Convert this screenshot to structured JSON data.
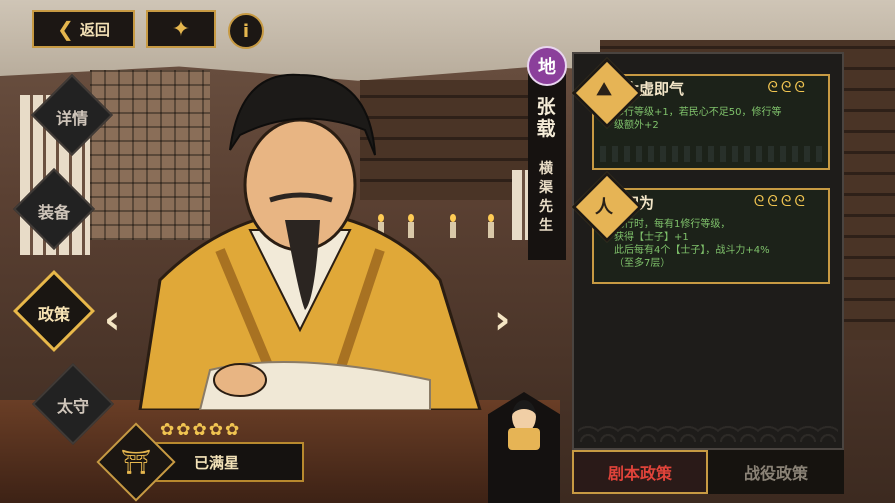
{
  "topbar": {
    "back_label": "返回",
    "back_icon": "chevron-left-icon",
    "gift_icon": "dancer-icon",
    "info_icon": "info-icon",
    "info_glyph": "i"
  },
  "side_nav": {
    "items": [
      {
        "label": "详情",
        "active": false
      },
      {
        "label": "装备",
        "active": false
      },
      {
        "label": "政策",
        "active": true
      },
      {
        "label": "太守",
        "active": false
      }
    ]
  },
  "character": {
    "rank_badge": "地",
    "name": "张载",
    "title": "横渠先生",
    "stars_label": "已满星",
    "stars_count": 5,
    "stars_glyphs": "✿✿✿✿✿"
  },
  "policies": [
    {
      "name": "太虚即气",
      "icon": "mountain-icon",
      "icon_glyph": "⛰",
      "level_glyphs": "ᘓᘓᘓ",
      "level": 3,
      "description": "修行等级+1，若民心不足50，修行等\n级额外+2"
    },
    {
      "name": "四为",
      "icon": "scholar-icon",
      "icon_glyph": "人",
      "level_glyphs": "ᘓᘓᘓᘓ",
      "level": 4,
      "description": "施行时，每有1修行等级，\n获得【士子】+1\n此后每有4个【士子】，战斗力+4%\n（至多7层）"
    }
  ],
  "tabs": [
    {
      "label": "剧本政策",
      "active": true
    },
    {
      "label": "战役政策",
      "active": false
    }
  ],
  "colors": {
    "accent_gold": "#c79a43",
    "active_tab_text": "#e0433a",
    "policy_text_green": "#7fc26b",
    "rank_purple": "#8b3f9b"
  }
}
